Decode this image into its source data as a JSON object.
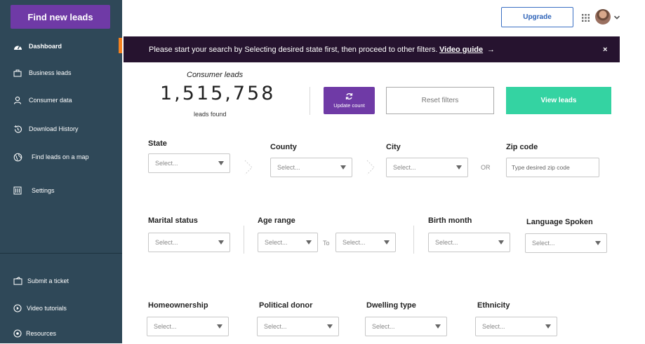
{
  "sidebar": {
    "cta_label": "Find new leads",
    "items": [
      {
        "label": "Dashboard",
        "icon": "dashboard-icon"
      },
      {
        "label": "Business leads",
        "icon": "briefcase-icon"
      },
      {
        "label": "Consumer data",
        "icon": "user-icon"
      },
      {
        "label": "Download History",
        "icon": "history-icon"
      },
      {
        "label": "Find leads on a map",
        "icon": "globe-icon"
      },
      {
        "label": "Settings",
        "icon": "settings-icon"
      }
    ],
    "bottom_items": [
      {
        "label": "Submit a ticket",
        "icon": "ticket-icon"
      },
      {
        "label": "Video tutorials",
        "icon": "play-icon"
      },
      {
        "label": "Resources",
        "icon": "resources-icon"
      }
    ]
  },
  "topbar": {
    "upgrade_label": "Upgrade"
  },
  "banner": {
    "message": "Please start your search by Selecting desired state first, then proceed to other filters.",
    "link_label": "Video guide",
    "arrow": "→",
    "close": "×"
  },
  "summary": {
    "title": "Consumer leads",
    "count": "1,515,758",
    "subtitle": "leads found"
  },
  "actions": {
    "update_label": "Update count",
    "reset_label": "Reset filters",
    "view_label": "View leads"
  },
  "filters": {
    "state": {
      "label": "State",
      "value": "Select..."
    },
    "county": {
      "label": "County",
      "value": "Select..."
    },
    "city": {
      "label": "City",
      "value": "Select..."
    },
    "or_label": "OR",
    "zip": {
      "label": "Zip code",
      "placeholder": "Type desired zip code"
    },
    "marital": {
      "label": "Marital status",
      "value": "Select..."
    },
    "age": {
      "label": "Age range",
      "from": "Select...",
      "to_label": "To",
      "to": "Select..."
    },
    "birth_month": {
      "label": "Birth month",
      "value": "Select..."
    },
    "language": {
      "label": "Language Spoken",
      "value": "Select..."
    },
    "homeownership": {
      "label": "Homeownership",
      "value": "Select..."
    },
    "political": {
      "label": "Political donor",
      "value": "Select..."
    },
    "dwelling": {
      "label": "Dwelling type",
      "value": "Select..."
    },
    "ethnicity": {
      "label": "Ethnicity",
      "value": "Select..."
    }
  },
  "colors": {
    "sidebar": "#2f4858",
    "primary": "#6f3aa6",
    "accent": "#34d3a2",
    "banner": "#26132f",
    "active_marker": "#f58220"
  }
}
